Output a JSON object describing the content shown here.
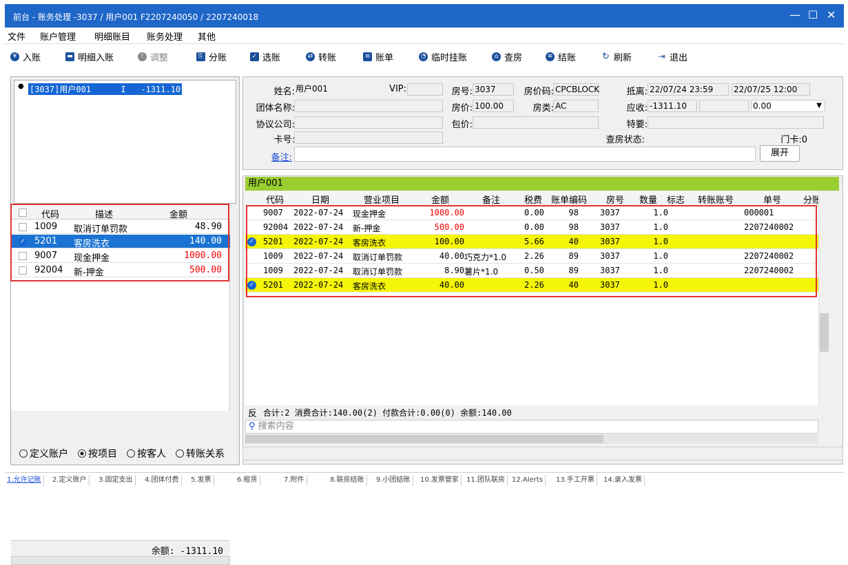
{
  "window": {
    "title": "前台 - 账务处理 -3037 / 用户001 F2207240050 / 2207240018"
  },
  "menu": [
    "文件",
    "账户管理",
    "明细账目",
    "账务处理",
    "其他"
  ],
  "toolbar": [
    {
      "label": "入账",
      "icon": "yen-icon"
    },
    {
      "label": "明细入账",
      "icon": "monitor-icon"
    },
    {
      "label": "调整",
      "icon": "adjust-icon"
    },
    {
      "label": "分账",
      "icon": "split-icon"
    },
    {
      "label": "选账",
      "icon": "select-icon"
    },
    {
      "label": "转账",
      "icon": "transfer-icon"
    },
    {
      "label": "账单",
      "icon": "bill-icon"
    },
    {
      "label": "临时挂账",
      "icon": "clock-icon"
    },
    {
      "label": "查房",
      "icon": "house-icon"
    },
    {
      "label": "结账",
      "icon": "stack-icon"
    },
    {
      "label": "刷新",
      "icon": "refresh-icon"
    },
    {
      "label": "退出",
      "icon": "exit-icon"
    }
  ],
  "account_list": {
    "selected": "[3037]用户001      I   -1311.10"
  },
  "left_grid": {
    "headers": [
      "代码",
      "描述",
      "金额"
    ],
    "rows": [
      {
        "code": "1009",
        "desc": "取消订单罚款",
        "amount": "48.90",
        "checked": false
      },
      {
        "code": "5201",
        "desc": "客房洗衣",
        "amount": "140.00",
        "checked": true
      },
      {
        "code": "9007",
        "desc": "现金押金",
        "amount": "1000.00",
        "checked": false
      },
      {
        "code": "92004",
        "desc": "新-押金",
        "amount": "500.00",
        "checked": false
      }
    ]
  },
  "balance": "余额: -1311.10",
  "radios": [
    {
      "label": "定义账户",
      "on": false
    },
    {
      "label": "按项目",
      "on": true
    },
    {
      "label": "按客人",
      "on": false
    },
    {
      "label": "转账关系",
      "on": false
    }
  ],
  "info": {
    "name_label": "姓名:",
    "name": "用户001",
    "vip_label": "VIP:",
    "vip": "",
    "room_no_label": "房号:",
    "room_no": "3037",
    "rate_code_label": "房价码:",
    "rate_code": "CPCBLOCK",
    "arrive_label": "抵离:",
    "arrive": "22/07/24 23:59",
    "depart": "22/07/25 12:00",
    "group_label": "团体名称:",
    "group": "",
    "rate_label": "房价:",
    "rate": "100.00",
    "room_type_label": "房类:",
    "room_type": "AC",
    "receivable_label": "应收:",
    "receivable": "-1311.10",
    "receivable2": "",
    "deposit": "0.00",
    "company_label": "协议公司:",
    "company": "",
    "package_label": "包价:",
    "package": "",
    "special_label": "特要:",
    "special": "",
    "card_label": "卡号:",
    "card": "",
    "checkroom_label": "查房状态:",
    "door_card": "门卡:0",
    "remark_label": "备注:",
    "remark": "",
    "expand": "展开"
  },
  "guest_bar": "用户001",
  "main_grid": {
    "headers": [
      "代码",
      "日期",
      "营业项目",
      "金额",
      "备注",
      "税费",
      "账单编码",
      "房号",
      "数量",
      "标志",
      "转账账号",
      "单号",
      "分账"
    ],
    "rows": [
      {
        "code": "9007",
        "date": "2022-07-24",
        "item": "现金押金",
        "amount": "1000.00",
        "note": "",
        "tax": "0.00",
        "bill": "98",
        "room": "3037",
        "qty": "1.0",
        "flag": "",
        "transfer": "",
        "no": "000001",
        "hl": false,
        "tick": false,
        "red": true
      },
      {
        "code": "92004",
        "date": "2022-07-24",
        "item": "新-押金",
        "amount": "500.00",
        "note": "",
        "tax": "0.00",
        "bill": "98",
        "room": "3037",
        "qty": "1.0",
        "flag": "",
        "transfer": "",
        "no": "2207240002",
        "hl": false,
        "tick": false,
        "red": true
      },
      {
        "code": "5201",
        "date": "2022-07-24",
        "item": "客房洗衣",
        "amount": "100.00",
        "note": "",
        "tax": "5.66",
        "bill": "40",
        "room": "3037",
        "qty": "1.0",
        "flag": "",
        "transfer": "",
        "no": "",
        "hl": true,
        "tick": true,
        "red": false
      },
      {
        "code": "1009",
        "date": "2022-07-24",
        "item": "取消订单罚款",
        "amount": "40.00",
        "note": "巧克力*1.0",
        "tax": "2.26",
        "bill": "89",
        "room": "3037",
        "qty": "1.0",
        "flag": "",
        "transfer": "",
        "no": "2207240002",
        "hl": false,
        "tick": false,
        "red": false
      },
      {
        "code": "1009",
        "date": "2022-07-24",
        "item": "取消订单罚款",
        "amount": "8.90",
        "note": "薯片*1.0",
        "tax": "0.50",
        "bill": "89",
        "room": "3037",
        "qty": "1.0",
        "flag": "",
        "transfer": "",
        "no": "2207240002",
        "hl": false,
        "tick": false,
        "red": false
      },
      {
        "code": "5201",
        "date": "2022-07-24",
        "item": "客房洗衣",
        "amount": "40.00",
        "note": "",
        "tax": "2.26",
        "bill": "40",
        "room": "3037",
        "qty": "1.0",
        "flag": "",
        "transfer": "",
        "no": "",
        "hl": true,
        "tick": true,
        "red": false
      }
    ]
  },
  "summary": {
    "reverse": "反",
    "text": "合计:2  消费合计:140.00(2)  付款合计:0.00(0)  余额:140.00"
  },
  "search": {
    "placeholder": "搜索内容"
  },
  "tabs": [
    "1.允许记账",
    "2.定义账户",
    "3.固定支出",
    "4.团体付费",
    "5.发票",
    "6.租赁",
    "7.附件",
    "8.联房结账",
    "9.小团结账",
    "10.发票管家",
    "11.团队联房",
    "12.Alerts",
    "13.手工开票",
    "14.录入发票"
  ]
}
